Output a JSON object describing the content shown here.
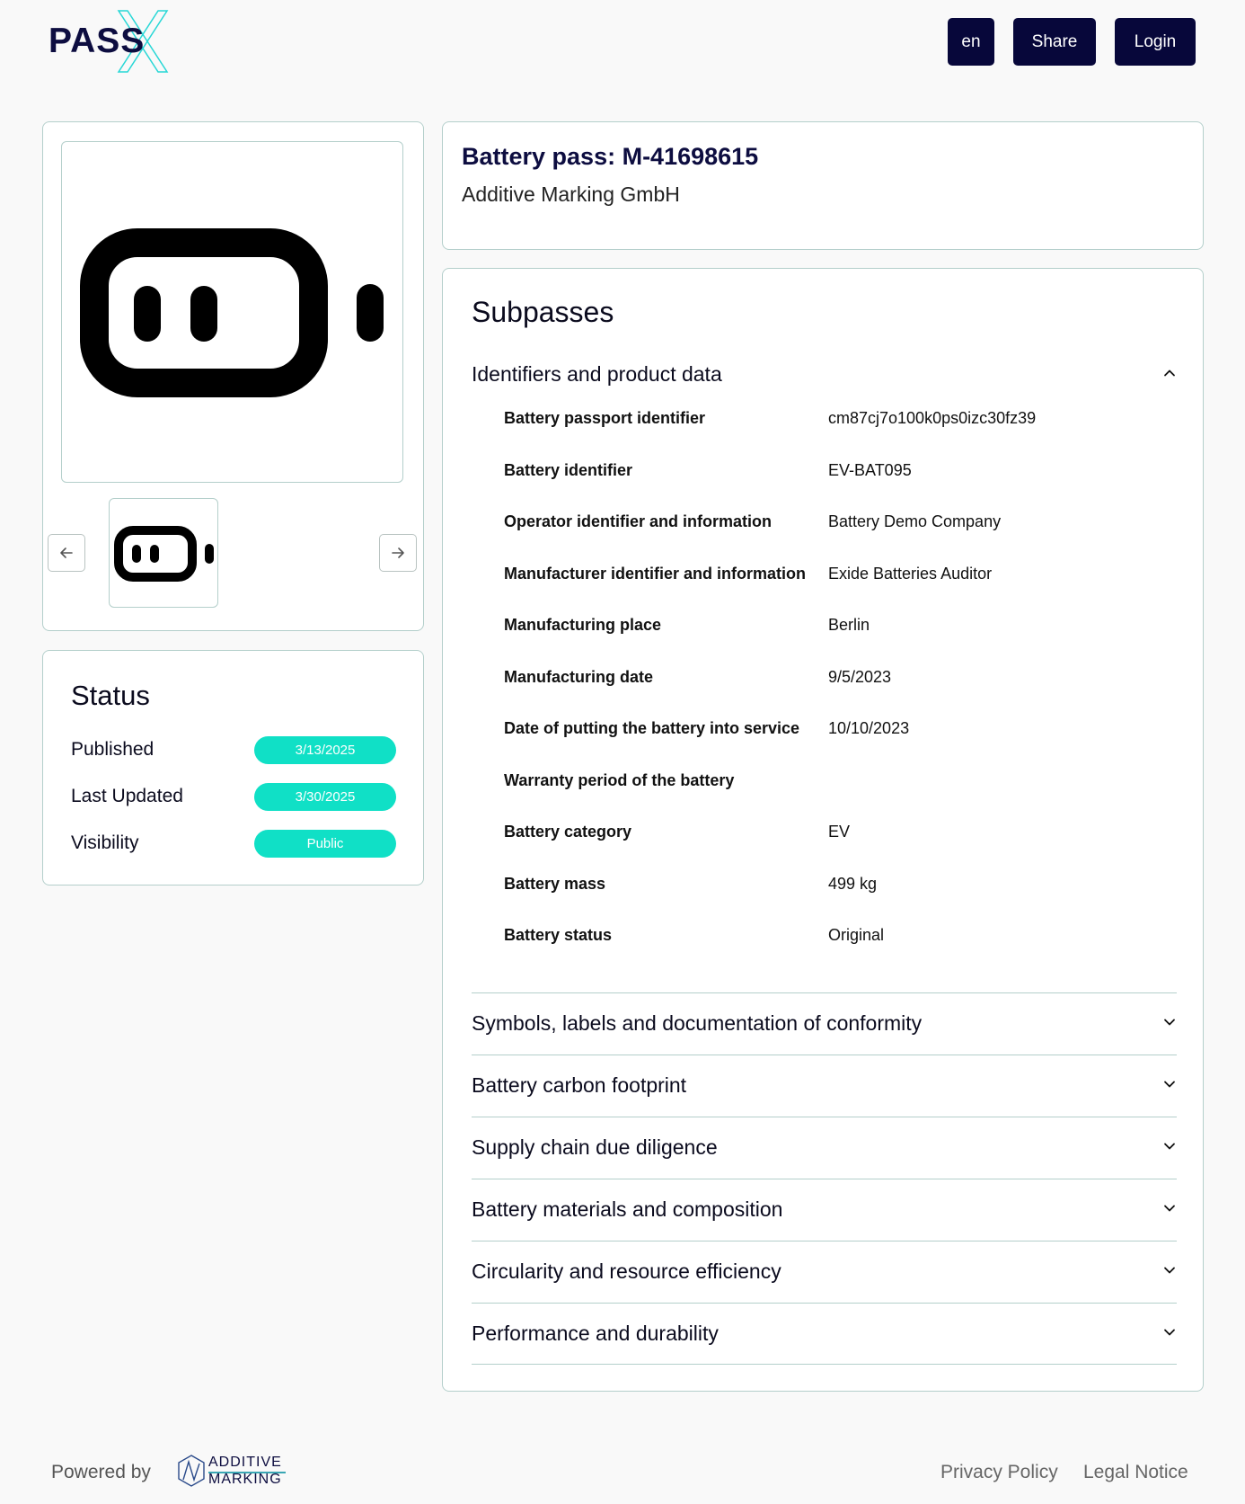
{
  "header": {
    "logo_text": "PASS",
    "logo_mark": "X",
    "lang_label": "en",
    "share_label": "Share",
    "login_label": "Login"
  },
  "gallery": {
    "main_image_icon": "battery-icon",
    "thumbnail_icon": "battery-icon",
    "prev_icon": "arrow-left-icon",
    "next_icon": "arrow-right-icon"
  },
  "status": {
    "title": "Status",
    "rows": [
      {
        "label": "Published",
        "value": "3/13/2025"
      },
      {
        "label": "Last Updated",
        "value": "3/30/2025"
      },
      {
        "label": "Visibility",
        "value": "Public"
      }
    ],
    "badge_color": "#10e0c6"
  },
  "pass": {
    "title": "Battery pass: M-41698615",
    "company": "Additive Marking GmbH"
  },
  "subpasses": {
    "title": "Subpasses",
    "open_section": {
      "label": "Identifiers and product data",
      "fields": [
        {
          "label": "Battery passport identifier",
          "value": "cm87cj7o100k0ps0izc30fz39"
        },
        {
          "label": "Battery identifier",
          "value": "EV-BAT095"
        },
        {
          "label": "Operator identifier and information",
          "value": "Battery Demo Company"
        },
        {
          "label": "Manufacturer identifier and information",
          "value": "Exide Batteries Auditor"
        },
        {
          "label": "Manufacturing place",
          "value": "Berlin"
        },
        {
          "label": "Manufacturing date",
          "value": "9/5/2023"
        },
        {
          "label": "Date of putting the battery into service",
          "value": "10/10/2023"
        },
        {
          "label": "Warranty period of the battery",
          "value": ""
        },
        {
          "label": "Battery category",
          "value": "EV"
        },
        {
          "label": "Battery mass",
          "value": "499 kg"
        },
        {
          "label": "Battery status",
          "value": "Original"
        }
      ]
    },
    "sections": [
      "Symbols, labels and documentation of conformity",
      "Battery carbon footprint",
      "Supply chain due diligence",
      "Battery materials and composition",
      "Circularity and resource efficiency",
      "Performance and durability"
    ]
  },
  "footer": {
    "powered_by": "Powered by",
    "partner_logo_line1": "ADDITIVE",
    "partner_logo_line2": "MARKING",
    "privacy": "Privacy Policy",
    "legal": "Legal Notice"
  },
  "colors": {
    "primary": "#07073a",
    "accent": "#10e0c6",
    "border": "#b4cfcb"
  }
}
